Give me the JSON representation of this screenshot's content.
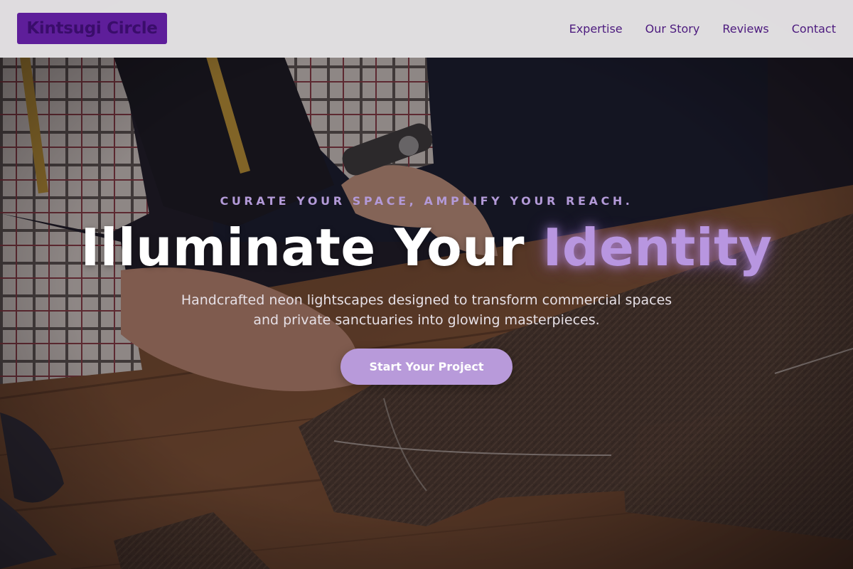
{
  "header": {
    "logo_text": "Kintsugi Circle",
    "nav": [
      {
        "label": "Expertise"
      },
      {
        "label": "Our Story"
      },
      {
        "label": "Reviews"
      },
      {
        "label": "Contact"
      }
    ]
  },
  "hero": {
    "tagline": "CURATE YOUR SPACE, AMPLIFY YOUR REACH.",
    "headline_main": "Illuminate Your",
    "headline_accent": "Identity",
    "subtitle": "Handcrafted neon lightscapes designed to transform commercial spaces and private sanctuaries into glowing masterpieces.",
    "cta_label": "Start Your Project",
    "background_image": "tailor-cutting-fabric-photo"
  },
  "colors": {
    "brand": "#5e1e9a",
    "nav_text": "#4c1a7e",
    "accent": "#b896e0",
    "cta": "#b89ada"
  }
}
